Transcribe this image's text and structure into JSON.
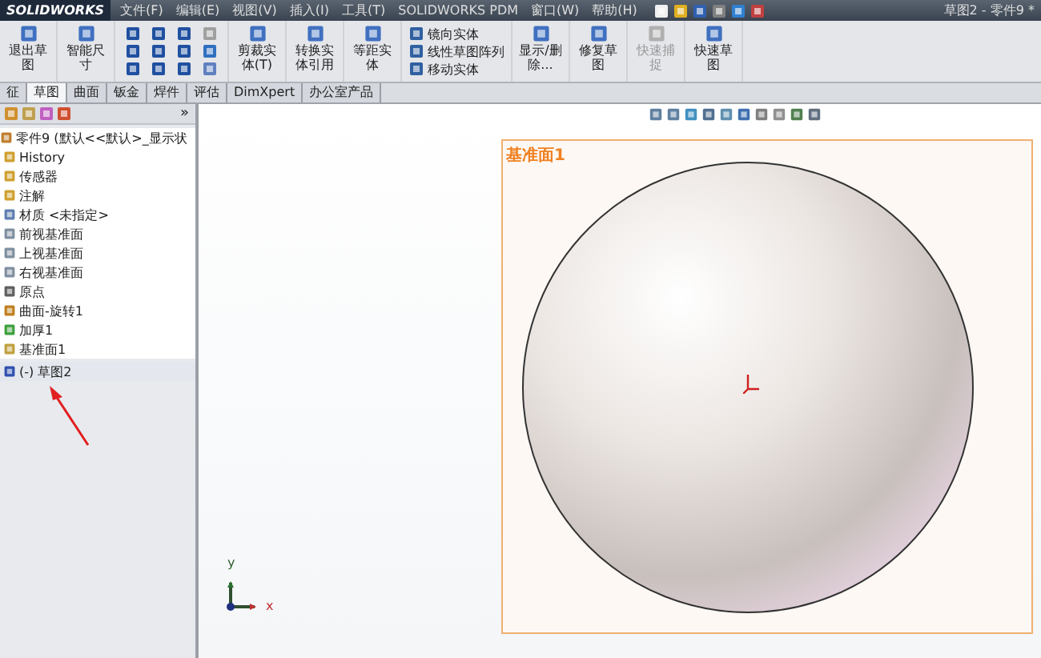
{
  "menu_bar": {
    "logo": "SOLIDWORKS",
    "items": [
      "文件(F)",
      "编辑(E)",
      "视图(V)",
      "插入(I)",
      "工具(T)",
      "SOLIDWORKS PDM",
      "窗口(W)",
      "帮助(H)"
    ],
    "title": "草图2 - 零件9 *"
  },
  "toolbar": [
    {
      "kind": "big",
      "label": "退出草图",
      "disabled": false
    },
    {
      "kind": "big",
      "label": "智能尺寸",
      "disabled": false
    },
    {
      "kind": "grid"
    },
    {
      "kind": "big",
      "label": "剪裁实体(T)",
      "disabled": false
    },
    {
      "kind": "big",
      "label": "转换实体引用",
      "disabled": false
    },
    {
      "kind": "big",
      "label": "等距实体",
      "disabled": false
    },
    {
      "kind": "list",
      "labels": [
        "镜向实体",
        "线性草图阵列",
        "移动实体"
      ]
    },
    {
      "kind": "big",
      "label": "显示/删除...",
      "disabled": false
    },
    {
      "kind": "big",
      "label": "修复草图",
      "disabled": false
    },
    {
      "kind": "big",
      "label": "快速捕捉",
      "disabled": true
    },
    {
      "kind": "big",
      "label": "快速草图",
      "disabled": false
    }
  ],
  "tabs": [
    {
      "label": "征",
      "selected": false
    },
    {
      "label": "草图",
      "selected": true
    },
    {
      "label": "曲面",
      "selected": false
    },
    {
      "label": "钣金",
      "selected": false
    },
    {
      "label": "焊件",
      "selected": false
    },
    {
      "label": "评估",
      "selected": false
    },
    {
      "label": "DimXpert",
      "selected": false
    },
    {
      "label": "办公室产品",
      "selected": false
    }
  ],
  "panel_toolbar": {
    "chevron": "»"
  },
  "tree": {
    "root": "零件9 (默认<<默认>_显示状",
    "items": [
      {
        "label": "History",
        "selected": false
      },
      {
        "label": "传感器",
        "selected": false
      },
      {
        "label": "注解",
        "selected": false
      },
      {
        "label": "材质 <未指定>",
        "selected": false
      },
      {
        "label": "前视基准面",
        "selected": false
      },
      {
        "label": "上视基准面",
        "selected": false
      },
      {
        "label": "右视基准面",
        "selected": false
      },
      {
        "label": "原点",
        "selected": false
      },
      {
        "label": "曲面-旋转1",
        "selected": false
      },
      {
        "label": "加厚1",
        "selected": false
      },
      {
        "label": "基准面1",
        "selected": false
      },
      {
        "label": "(-) 草图2",
        "selected": true
      }
    ]
  },
  "viewport": {
    "plane_label": "基准面1",
    "axis_x": "x",
    "axis_y": "y"
  }
}
